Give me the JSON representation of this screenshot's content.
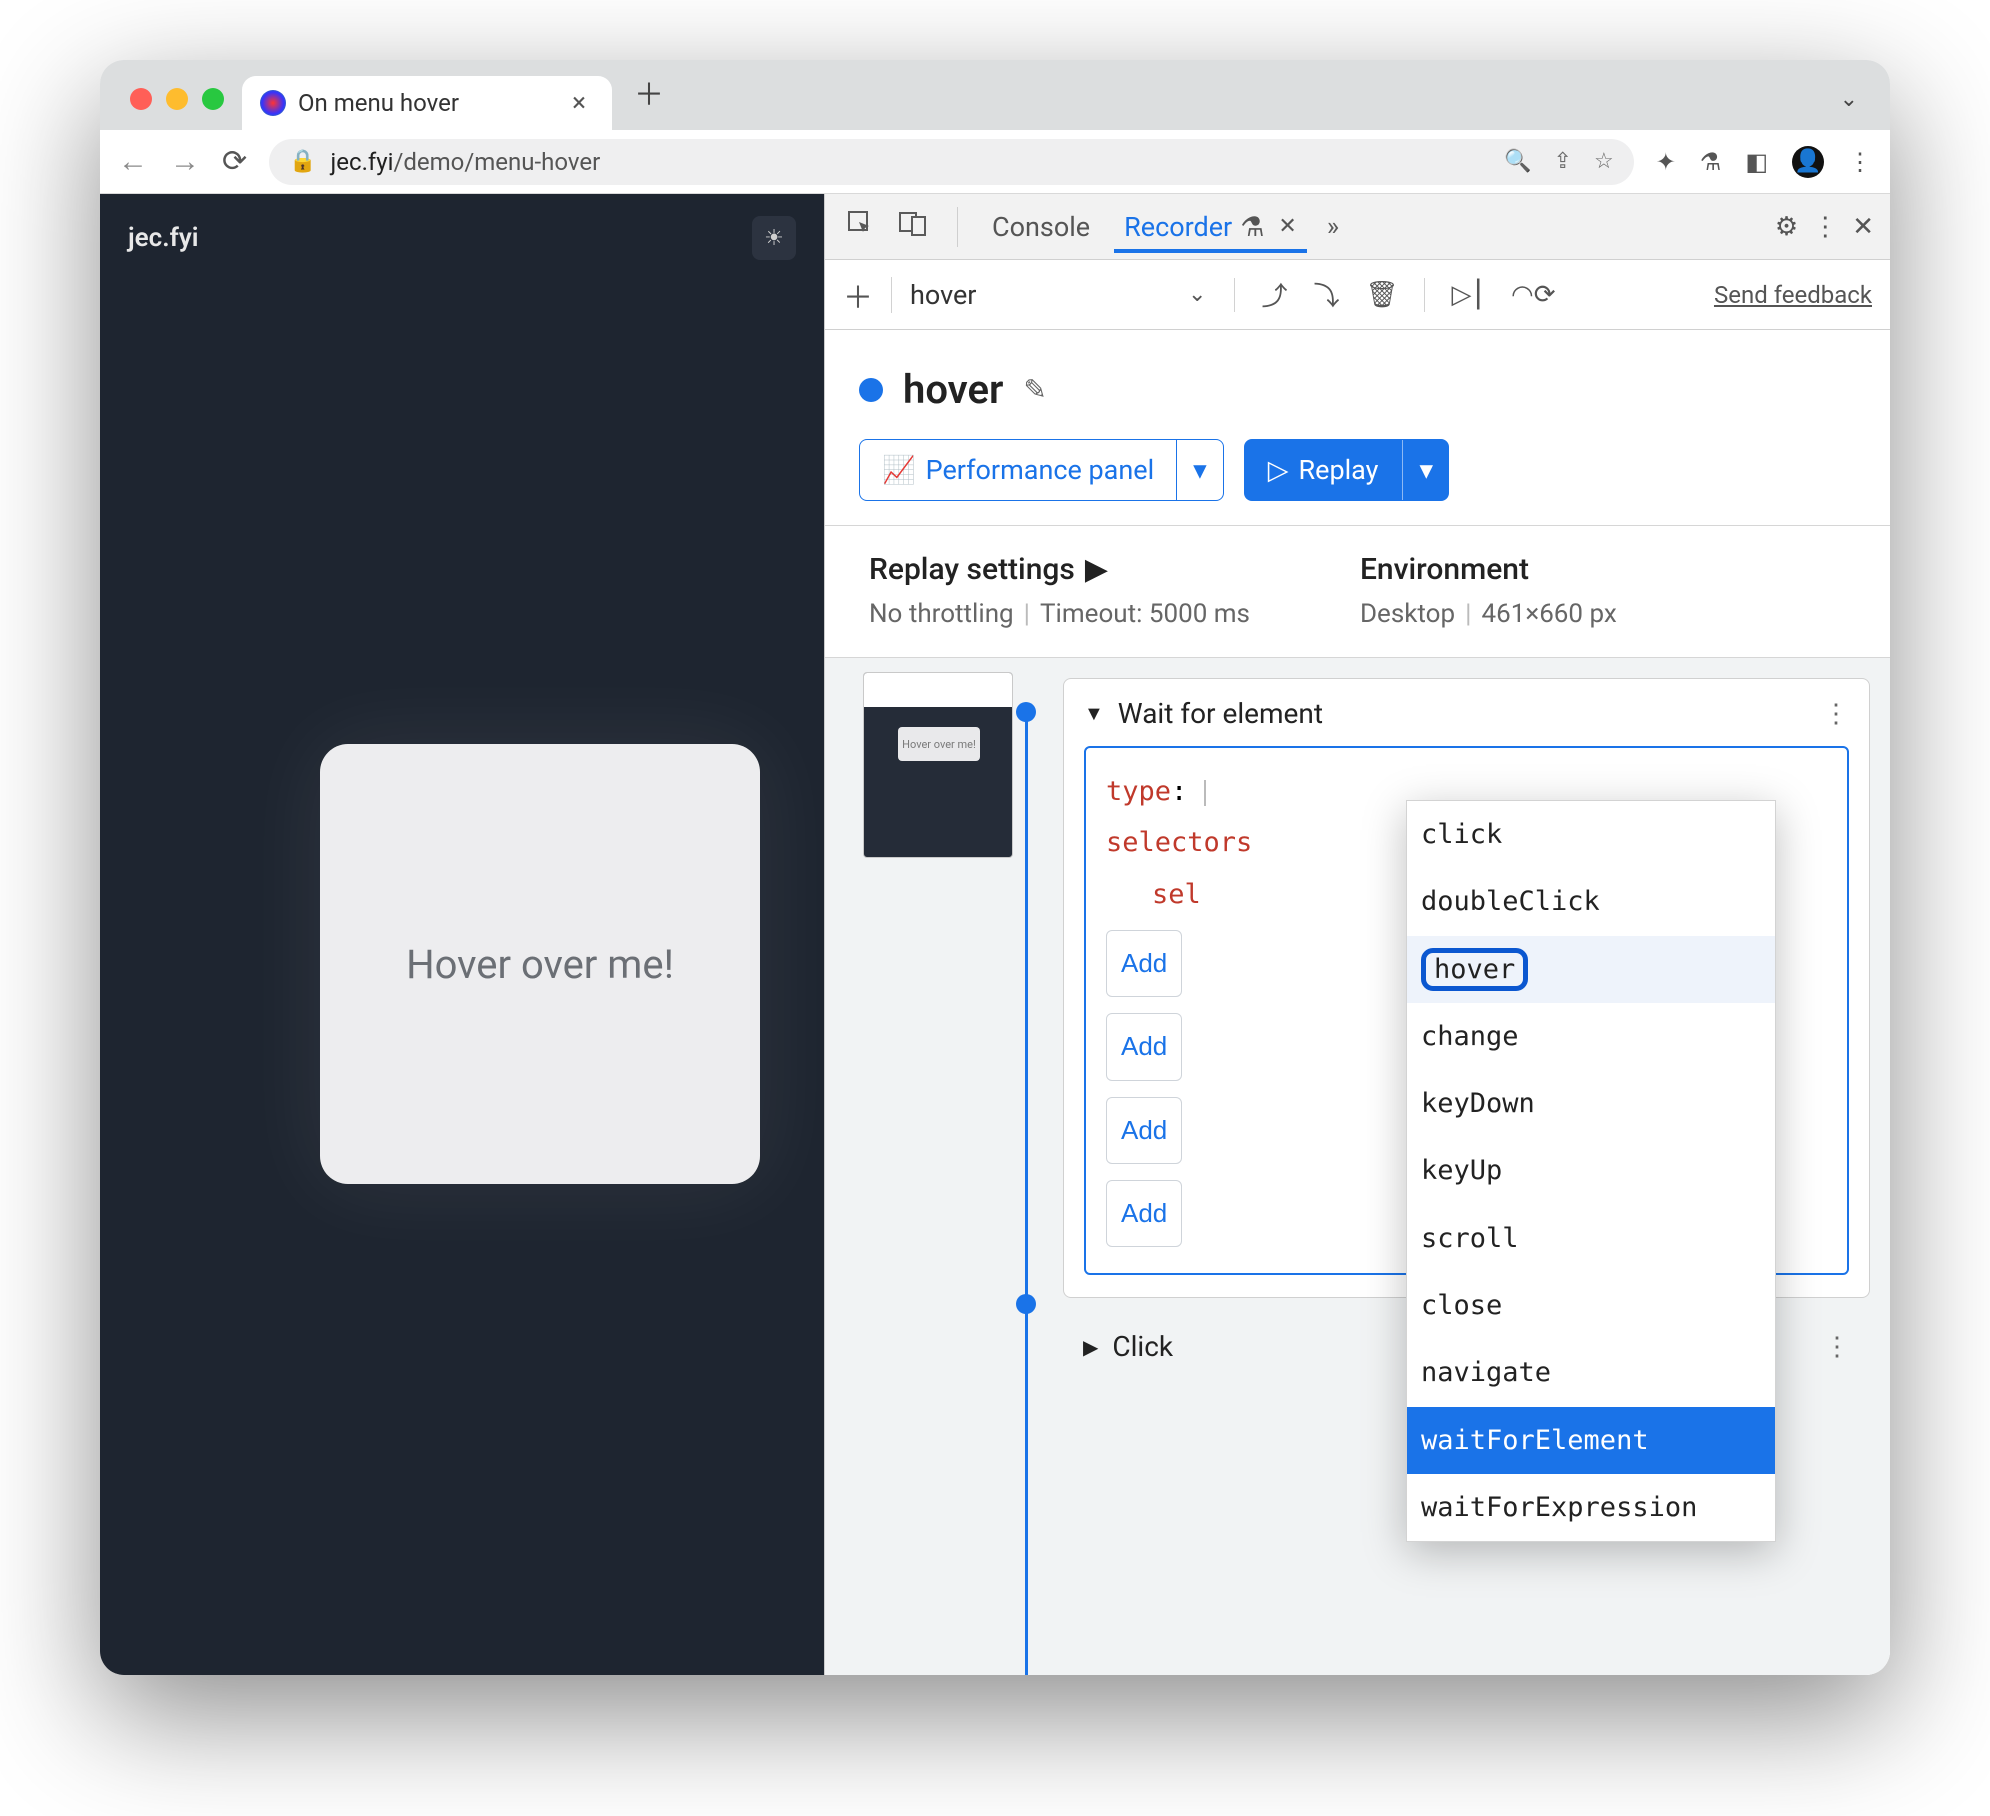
{
  "browser": {
    "tab_title": "On menu hover",
    "url_host": "jec.fyi",
    "url_path": "/demo/menu-hover"
  },
  "leftpane": {
    "brand": "jec.fyi",
    "hover_text": "Hover over me!",
    "thumb_label": "Hover over me!"
  },
  "devtools": {
    "tab_console": "Console",
    "tab_recorder": "Recorder",
    "recording_name": "hover",
    "feedback": "Send feedback"
  },
  "panel": {
    "title": "hover",
    "perf_button": "Performance panel",
    "replay_button": "Replay"
  },
  "settings": {
    "replay_heading": "Replay settings",
    "throttling": "No throttling",
    "timeout": "Timeout: 5000 ms",
    "env_heading": "Environment",
    "env_device": "Desktop",
    "env_size": "461×660 px"
  },
  "step": {
    "title": "Wait for element",
    "type_key": "type",
    "selectors_key": "selectors",
    "sel_key": "sel",
    "add_label": "Add",
    "click_title": "Click"
  },
  "dropdown": {
    "options": [
      "click",
      "doubleClick",
      "hover",
      "change",
      "keyDown",
      "keyUp",
      "scroll",
      "close",
      "navigate",
      "waitForElement",
      "waitForExpression"
    ],
    "highlighted": "hover",
    "selected": "waitForElement"
  }
}
